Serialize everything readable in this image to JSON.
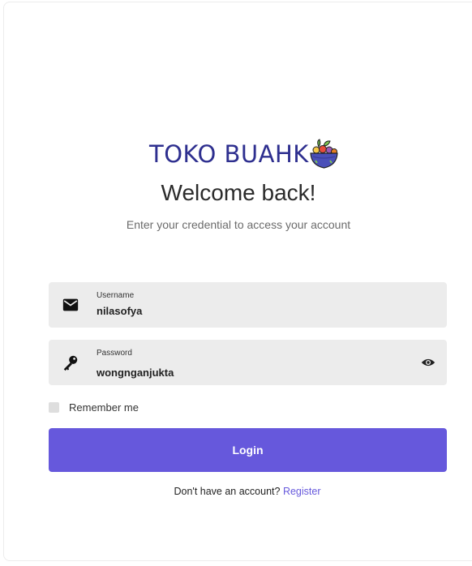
{
  "logo": {
    "text": "TOKO BUAHK",
    "icon": "fruit-salad-bowl-icon"
  },
  "header": {
    "title": "Welcome back!",
    "subtitle": "Enter your credential to access your account"
  },
  "form": {
    "username": {
      "label": "Username",
      "value": "nilasofya",
      "icon": "mail-icon"
    },
    "password": {
      "label": "Password",
      "value": "wongnganjukta",
      "icon": "key-icon",
      "toggle_icon": "eye-icon"
    },
    "remember_label": "Remember me",
    "login_label": "Login"
  },
  "footer": {
    "prompt": "Don't have an account?",
    "register_label": "Register"
  },
  "colors": {
    "accent": "#6658dc",
    "brand": "#2e2f8f",
    "field_bg": "#ececec"
  }
}
